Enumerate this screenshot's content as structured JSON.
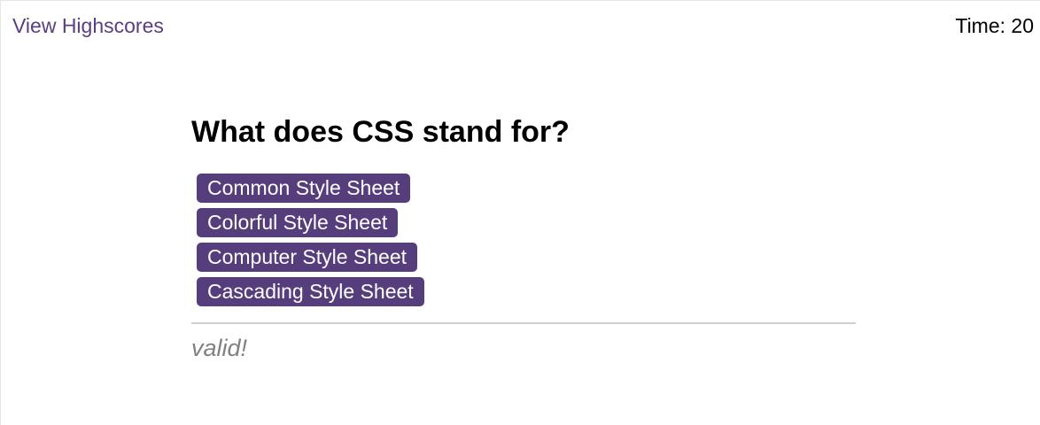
{
  "header": {
    "highscores_link": "View Highscores",
    "timer": "Time: 20"
  },
  "quiz": {
    "question": "What does CSS stand for?",
    "choices": [
      "Common Style Sheet",
      "Colorful Style Sheet",
      "Computer Style Sheet",
      "Cascading Style Sheet"
    ],
    "feedback": "valid!"
  },
  "colors": {
    "accent": "#563d7c",
    "link": "#5a3d85",
    "feedback": "#808080"
  }
}
